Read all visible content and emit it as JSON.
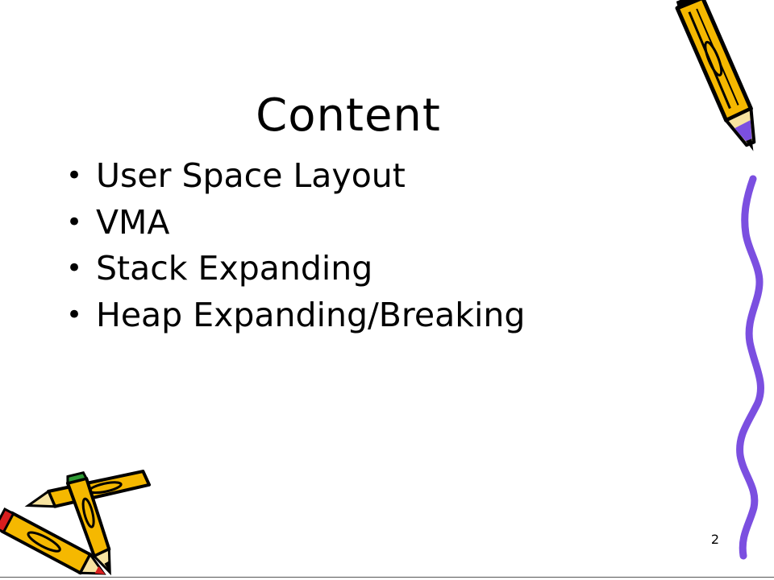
{
  "slide": {
    "title": "Content",
    "bullets": [
      {
        "text": "User Space Layout"
      },
      {
        "text": "VMA"
      },
      {
        "text": "Stack Expanding"
      },
      {
        "text": "Heap Expanding/Breaking"
      }
    ],
    "bullet_symbol": "•",
    "page_number": "2"
  },
  "decorations": {
    "pencil_top_right": "pencil-icon",
    "wavy_line_right": "wavy-line-border",
    "pencils_bottom_left": "crossed-pencils-icon",
    "colors": {
      "pencil_body": "#f5b800",
      "purple_line": "#7b4fe0",
      "eraser_green": "#2e9b35",
      "eraser_red": "#d81e1e"
    }
  }
}
